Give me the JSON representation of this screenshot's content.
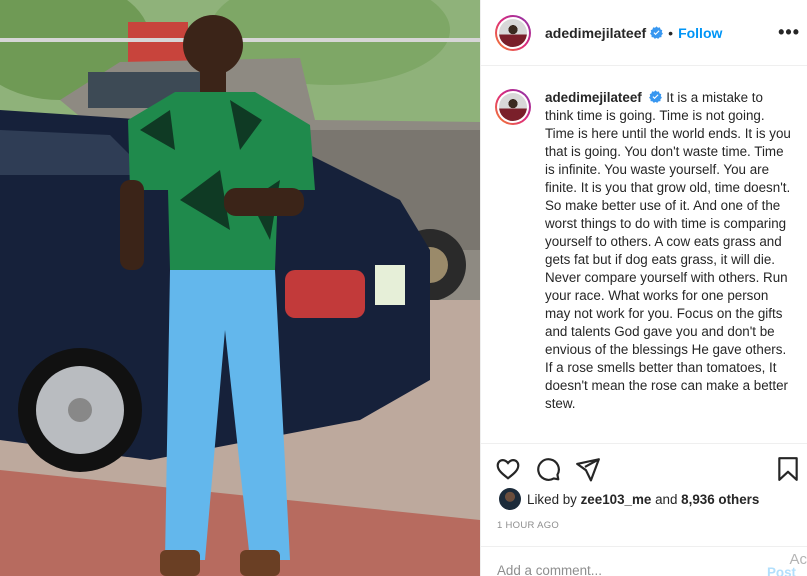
{
  "post": {
    "username": "adedimejilateef",
    "follow_label": "Follow",
    "dot": "•",
    "more_label": "•••",
    "caption_username": "adedimejilateef",
    "caption": "It is a mistake to think time is going. Time is not going. Time is here until the world ends. It is you that is going. You don't waste time. Time is infinite. You waste yourself. You are finite. It is you that grow old, time doesn't. So make better use of it. And one of the worst things to do with time is comparing yourself to others. A cow eats grass and gets fat but if dog eats grass, it will die. Never compare yourself with others. Run your race. What works for one person may not work for you. Focus on the gifts and talents God gave you and don't be envious of the blessings He gave others. If a rose smells better than tomatoes, It doesn't mean the rose can make a better stew.",
    "likes_prefix": "Liked by",
    "liked_by_user": "zee103_me",
    "likes_and": "and",
    "likes_count": "8,936 others",
    "timestamp": "1 HOUR AGO",
    "comment_placeholder": "Add a comment...",
    "post_button": "Post",
    "overflow_fragment": "Ac"
  },
  "icons": {
    "verified": "verified-badge-icon",
    "like": "heart-icon",
    "comment": "comment-bubble-icon",
    "share": "paper-plane-icon",
    "save": "bookmark-icon"
  },
  "colors": {
    "accent": "#0095f6",
    "text": "#262626",
    "muted": "#8e8e8e",
    "border": "#efefef"
  }
}
